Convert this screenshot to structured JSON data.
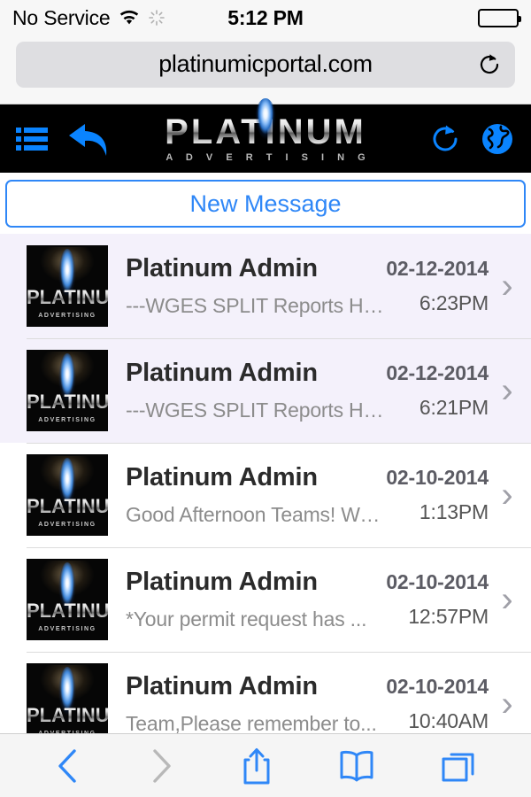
{
  "status_bar": {
    "carrier": "No Service",
    "time": "5:12 PM",
    "wifi_icon": "wifi-icon",
    "activity_icon": "spinner-icon",
    "battery_icon": "battery-icon"
  },
  "browser": {
    "url": "platinumicportal.com",
    "reload_icon": "reload-icon",
    "toolbar": {
      "back_icon": "back-chevron-icon",
      "forward_icon": "forward-chevron-icon",
      "share_icon": "share-icon",
      "bookmarks_icon": "book-icon",
      "tabs_icon": "tabs-icon"
    },
    "accent_color": "#2f87f7",
    "disabled_color": "#b8b8b8"
  },
  "app_header": {
    "menu_icon": "list-menu-icon",
    "reply_icon": "reply-arrow-icon",
    "refresh_icon": "refresh-icon",
    "globe_icon": "globe-icon",
    "logo_primary": "PLATINUM",
    "logo_secondary": "A D V E R T I S I N G",
    "accent_color": "#0a84ff",
    "background_color": "#000000"
  },
  "actions": {
    "new_message_label": "New Message"
  },
  "messages": {
    "avatar_primary": "PLATINUM",
    "avatar_secondary": "ADVERTISING",
    "chevron_glyph": "›",
    "unread_background": "#f4f1fb",
    "items": [
      {
        "sender": "Platinum Admin",
        "preview": "---WGES SPLIT Reports Ha...",
        "date": "02-12-2014",
        "time": "6:23PM",
        "unread": true
      },
      {
        "sender": "Platinum Admin",
        "preview": "---WGES SPLIT Reports Ha...",
        "date": "02-12-2014",
        "time": "6:21PM",
        "unread": true
      },
      {
        "sender": "Platinum Admin",
        "preview": "Good Afternoon Teams! We...",
        "date": "02-10-2014",
        "time": "1:13PM",
        "unread": false
      },
      {
        "sender": "Platinum Admin",
        "preview": "*Your permit request has ...",
        "date": "02-10-2014",
        "time": "12:57PM",
        "unread": false
      },
      {
        "sender": "Platinum Admin",
        "preview": "Team,Please remember to...",
        "date": "02-10-2014",
        "time": "10:40AM",
        "unread": false
      }
    ]
  }
}
